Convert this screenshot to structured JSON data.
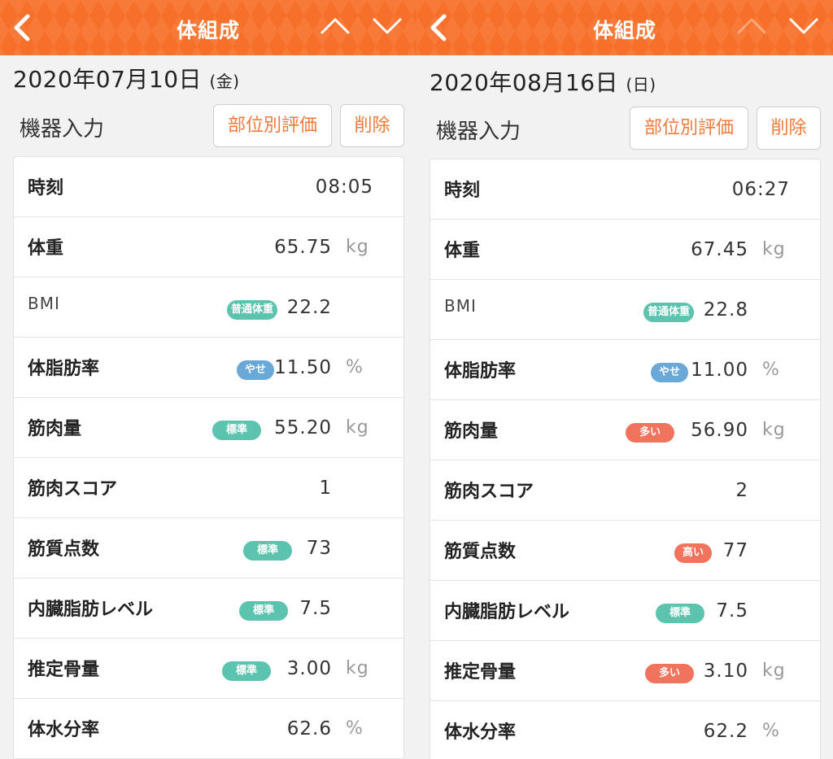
{
  "header": {
    "title": "体組成"
  },
  "section_title": "機器入力",
  "buttons": {
    "eval": "部位別評価",
    "delete": "削除"
  },
  "colors": {
    "header_bg": "#f7702a",
    "accent_text": "#f07a3c",
    "badge_teal": "#5cc4ae",
    "badge_blue": "#6aa8d8",
    "badge_red": "#f0735e"
  },
  "left": {
    "date": "2020年07月10日",
    "dow": "(金)",
    "rows": {
      "time": {
        "label": "時刻",
        "value": "08:05"
      },
      "weight": {
        "label": "体重",
        "value": "65.75",
        "unit": "kg"
      },
      "bmi": {
        "label": "BMI",
        "badge": "普通体重",
        "value": "22.2"
      },
      "bodyfat": {
        "label": "体脂肪率",
        "badge": "やせ",
        "value": "11.50",
        "unit": "%"
      },
      "muscle": {
        "label": "筋肉量",
        "badge": "標準",
        "value": "55.20",
        "unit": "kg"
      },
      "muscle_score": {
        "label": "筋肉スコア",
        "value": "1"
      },
      "muscle_quality": {
        "label": "筋質点数",
        "badge": "標準",
        "value": "73"
      },
      "visceral": {
        "label": "内臓脂肪レベル",
        "badge": "標準",
        "value": "7.5"
      },
      "bone": {
        "label": "推定骨量",
        "badge": "標準",
        "value": "3.00",
        "unit": "kg"
      },
      "water": {
        "label": "体水分率",
        "value": "62.6",
        "unit": "%"
      }
    }
  },
  "right": {
    "date": "2020年08月16日",
    "dow": "(日)",
    "rows": {
      "time": {
        "label": "時刻",
        "value": "06:27"
      },
      "weight": {
        "label": "体重",
        "value": "67.45",
        "unit": "kg"
      },
      "bmi": {
        "label": "BMI",
        "badge": "普通体重",
        "value": "22.8"
      },
      "bodyfat": {
        "label": "体脂肪率",
        "badge": "やせ",
        "value": "11.00",
        "unit": "%"
      },
      "muscle": {
        "label": "筋肉量",
        "badge": "多い",
        "value": "56.90",
        "unit": "kg"
      },
      "muscle_score": {
        "label": "筋肉スコア",
        "value": "2"
      },
      "muscle_quality": {
        "label": "筋質点数",
        "badge": "高い",
        "value": "77"
      },
      "visceral": {
        "label": "内臓脂肪レベル",
        "badge": "標準",
        "value": "7.5"
      },
      "bone": {
        "label": "推定骨量",
        "badge": "多い",
        "value": "3.10",
        "unit": "kg"
      },
      "water": {
        "label": "体水分率",
        "value": "62.2",
        "unit": "%"
      }
    }
  }
}
